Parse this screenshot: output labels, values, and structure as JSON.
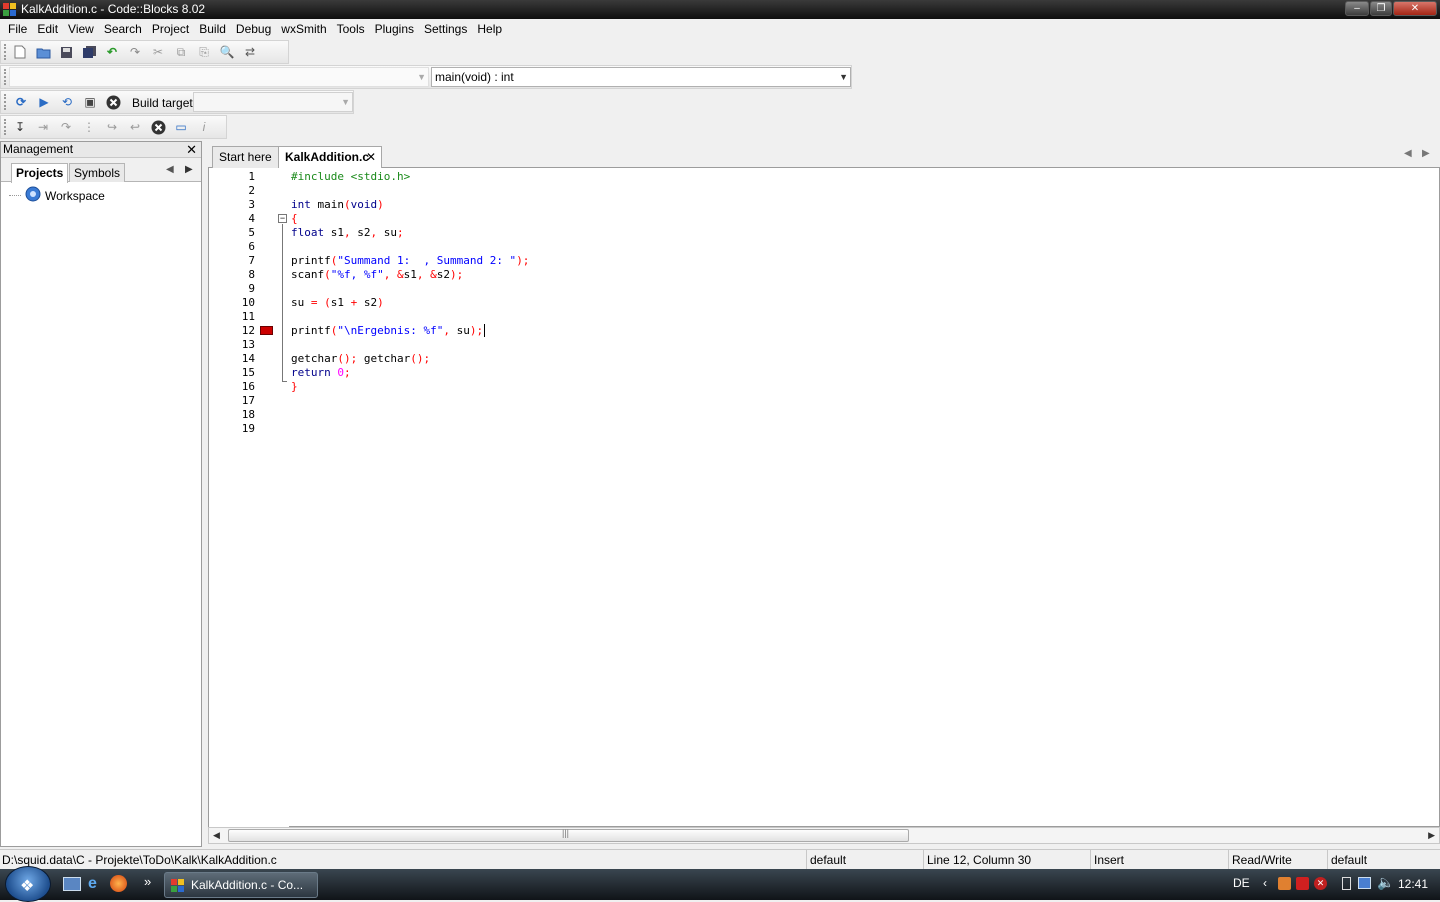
{
  "window": {
    "title": "KalkAddition.c - Code::Blocks 8.02",
    "controls": [
      "minimize",
      "restore",
      "close"
    ]
  },
  "menu": [
    "File",
    "Edit",
    "View",
    "Search",
    "Project",
    "Build",
    "Debug",
    "wxSmith",
    "Tools",
    "Plugins",
    "Settings",
    "Help"
  ],
  "toolbar": {
    "scope_select": "",
    "function_select": "main(void) : int",
    "build_target_label": "Build target:",
    "build_target_value": ""
  },
  "management": {
    "title": "Management",
    "tabs": [
      "Projects",
      "Symbols"
    ],
    "active_tab": "Projects",
    "tree_root": "Workspace"
  },
  "editor": {
    "tabs": [
      "Start here",
      "KalkAddition.c"
    ],
    "active_tab": "KalkAddition.c",
    "line_numbers": [
      "1",
      "2",
      "3",
      "4",
      "5",
      "6",
      "7",
      "8",
      "9",
      "10",
      "11",
      "12",
      "13",
      "14",
      "15",
      "16",
      "17",
      "18",
      "19"
    ],
    "breakpoint_line": 12,
    "fold_line": 4,
    "code_lines": [
      "#include <stdio.h>",
      "",
      "int main(void)",
      "{",
      "float s1, s2, su;",
      "",
      "printf(\"Summand 1:  , Summand 2: \");",
      "scanf(\"%f, %f\", &s1, &s2);",
      "",
      "su = (s1 + s2)",
      "",
      "printf(\"\\nErgebnis: %f\", su);",
      "",
      "getchar(); getchar();",
      "return 0;",
      "}",
      "",
      "",
      ""
    ]
  },
  "status": {
    "file_path": "D:\\squid.data\\C - Projekte\\ToDo\\Kalk\\KalkAddition.c",
    "encoding": "default",
    "position": "Line 12, Column 30",
    "mode": "Insert",
    "access": "Read/Write",
    "lang": "default"
  },
  "taskbar": {
    "task_label": "KalkAddition.c - Co...",
    "language": "DE",
    "clock": "12:41"
  },
  "colors": {
    "keyword": "#00008b",
    "string": "#0000ff",
    "preprocessor": "#1a8a1a",
    "operator": "#ff0000",
    "number": "#ff00ff",
    "breakpoint": "#cc0000"
  }
}
